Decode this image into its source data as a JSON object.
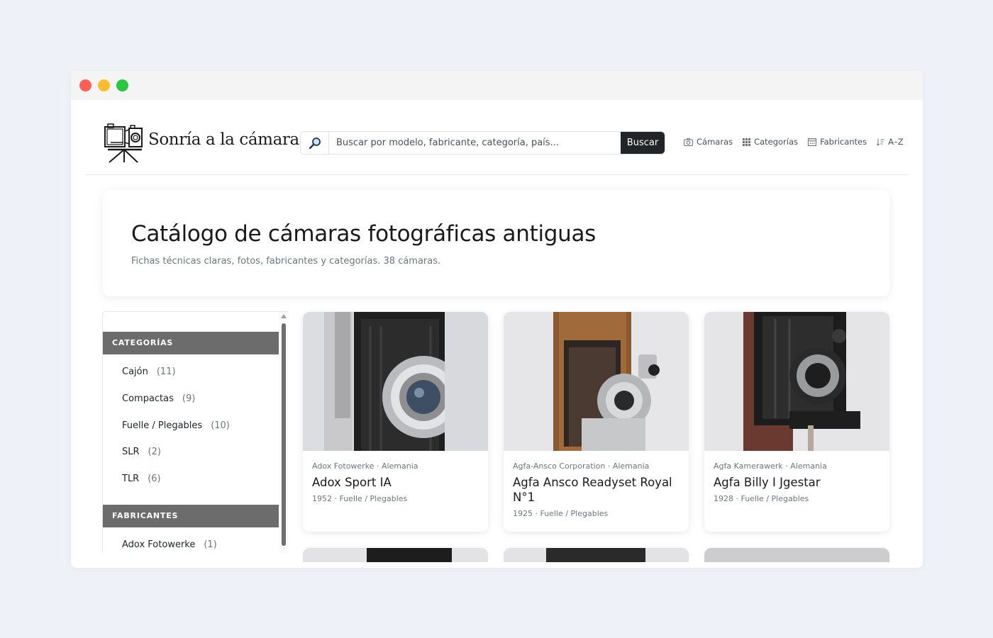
{
  "brand": {
    "name": "Sonría a la cámara"
  },
  "search": {
    "placeholder": "Buscar por modelo, fabricante, categoría, país...",
    "button_label": "Buscar"
  },
  "nav": [
    {
      "label": "Cámaras",
      "icon": "camera-icon"
    },
    {
      "label": "Categorías",
      "icon": "grid-icon"
    },
    {
      "label": "Fabricantes",
      "icon": "building-icon"
    },
    {
      "label": "A–Z",
      "icon": "sort-alpha-icon"
    }
  ],
  "hero": {
    "title": "Catálogo de cámaras fotográficas antiguas",
    "subtitle": "Fichas técnicas claras, fotos, fabricantes y categorías. 38 cámaras."
  },
  "sidebar": {
    "categories_heading": "CATEGORÍAS",
    "categories": [
      {
        "label": "Cajón",
        "count": "(11)"
      },
      {
        "label": "Compactas",
        "count": "(9)"
      },
      {
        "label": "Fuelle / Plegables",
        "count": "(10)"
      },
      {
        "label": "SLR",
        "count": "(2)"
      },
      {
        "label": "TLR",
        "count": "(6)"
      }
    ],
    "manufacturers_heading": "FABRICANTES",
    "manufacturers": [
      {
        "label": "Adox Fotowerke",
        "count": "(1)"
      }
    ]
  },
  "cards": [
    {
      "meta": "Adox Fotowerke · Alemania",
      "title": "Adox Sport IA",
      "info": "1952 · Fuelle / Plegables"
    },
    {
      "meta": "Agfa-Ansco Corporation · Alemania",
      "title": "Agfa Ansco Readyset Royal N°1",
      "info": "1925 · Fuelle / Plegables"
    },
    {
      "meta": "Agfa Kamerawerk · Alemania",
      "title": "Agfa Billy I Jgestar",
      "info": "1928 · Fuelle / Plegables"
    }
  ],
  "colors": {
    "section_header": "#6c6c6c",
    "button_dark": "#212529",
    "page_bg": "#eef1f7"
  }
}
